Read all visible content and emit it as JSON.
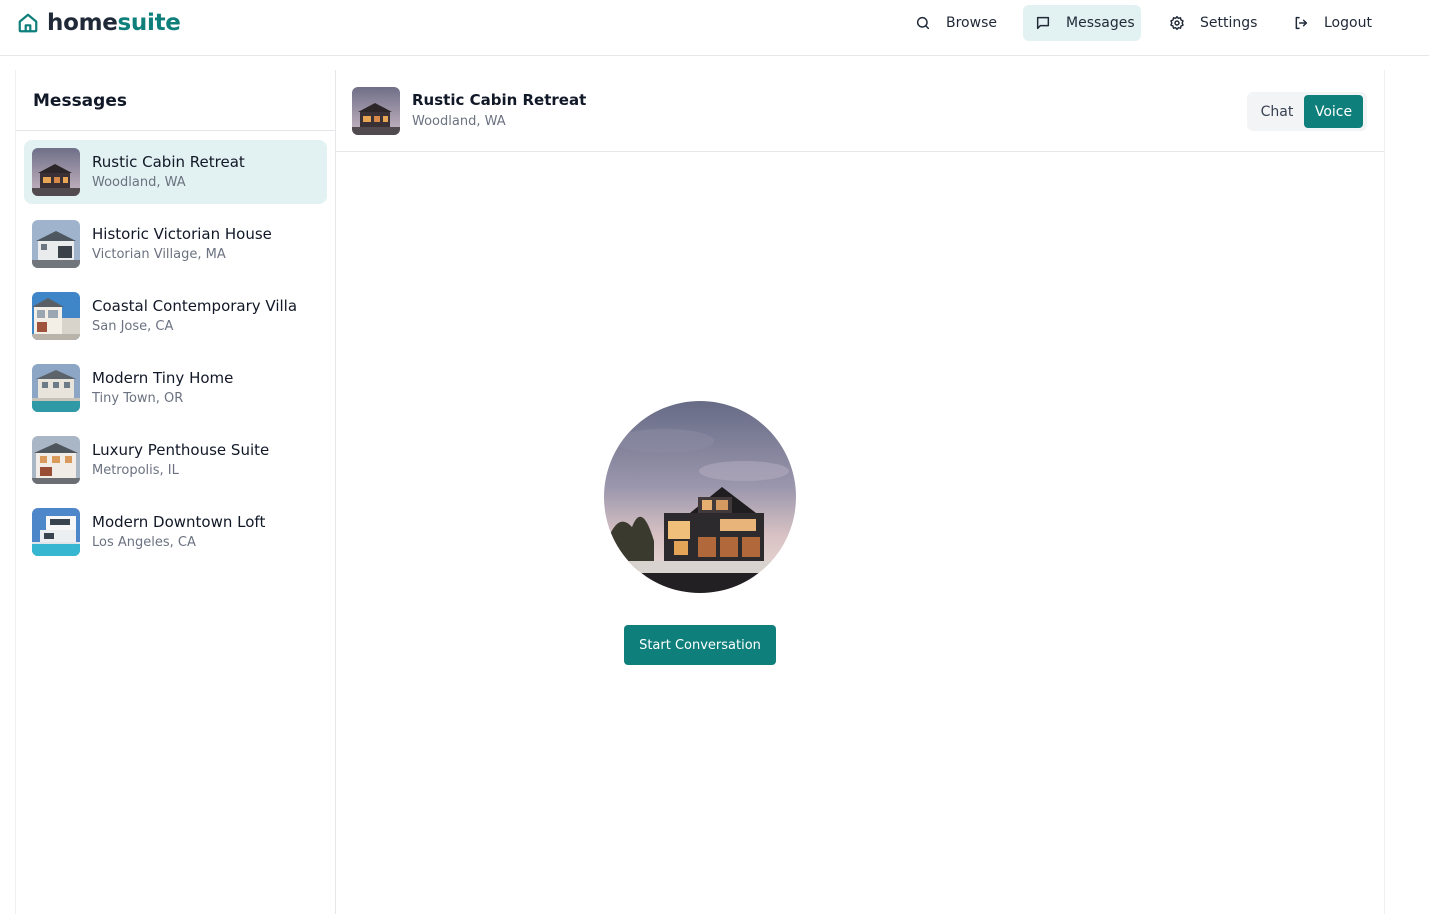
{
  "brand": {
    "home": "home",
    "suite": "suite",
    "icon": "house-icon",
    "accent": "#0f7f7c"
  },
  "nav": {
    "items": [
      {
        "label": "Browse",
        "icon": "search-icon",
        "active": false
      },
      {
        "label": "Messages",
        "icon": "message-square-icon",
        "active": true
      },
      {
        "label": "Settings",
        "icon": "gear-icon",
        "active": false
      },
      {
        "label": "Logout",
        "icon": "logout-icon",
        "active": false
      }
    ]
  },
  "sidebar": {
    "title": "Messages",
    "conversations": [
      {
        "name": "Rustic Cabin Retreat",
        "location": "Woodland, WA",
        "active": true
      },
      {
        "name": "Historic Victorian House",
        "location": "Victorian Village, MA",
        "active": false
      },
      {
        "name": "Coastal Contemporary Villa",
        "location": "San Jose, CA",
        "active": false
      },
      {
        "name": "Modern Tiny Home",
        "location": "Tiny Town, OR",
        "active": false
      },
      {
        "name": "Luxury Penthouse Suite",
        "location": "Metropolis, IL",
        "active": false
      },
      {
        "name": "Modern Downtown Loft",
        "location": "Los Angeles, CA",
        "active": false
      }
    ]
  },
  "main": {
    "header": {
      "name": "Rustic Cabin Retreat",
      "location": "Woodland, WA"
    },
    "mode_toggle": {
      "chat": "Chat",
      "voice": "Voice",
      "selected": "Voice"
    },
    "start_button": "Start Conversation"
  }
}
